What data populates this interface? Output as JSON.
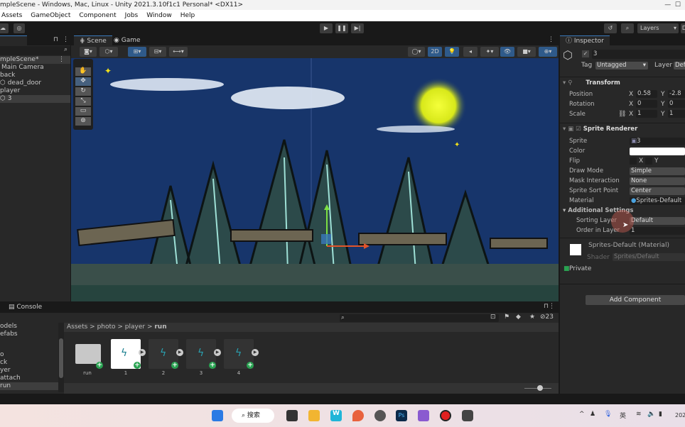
{
  "window": {
    "title": "mpleScene - Windows, Mac, Linux - Unity 2021.3.10f1c1 Personal* <DX11>"
  },
  "menu": [
    "Assets",
    "GameObject",
    "Component",
    "Jobs",
    "Window",
    "Help"
  ],
  "toolbar": {
    "layers_label": "Layers",
    "play": "▶",
    "pause": "❚❚",
    "step": "▶|"
  },
  "hierarchy": {
    "scene": "mpleScene*",
    "items": [
      {
        "label": "Main Camera"
      },
      {
        "label": "back"
      },
      {
        "label": "dead_door"
      },
      {
        "label": "player"
      },
      {
        "label": "3"
      }
    ]
  },
  "scene": {
    "tabs": [
      "Scene",
      "Game"
    ],
    "mode_2d": "2D"
  },
  "inspector": {
    "tab": "Inspector",
    "object_name": "3",
    "tag_label": "Tag",
    "tag": "Untagged",
    "layer_label": "Layer",
    "layer": "Def",
    "transform": {
      "title": "Transform",
      "position": {
        "label": "Position",
        "x": "0.58",
        "y": "-2.8"
      },
      "rotation": {
        "label": "Rotation",
        "x": "0",
        "y": "0"
      },
      "scale": {
        "label": "Scale",
        "x": "1",
        "y": "1"
      }
    },
    "sprite_renderer": {
      "title": "Sprite Renderer",
      "sprite_label": "Sprite",
      "sprite": "3",
      "color_label": "Color",
      "flip_label": "Flip",
      "flip_x": "X",
      "flip_y": "Y",
      "draw_mode_label": "Draw Mode",
      "draw_mode": "Simple",
      "mask_label": "Mask Interaction",
      "mask": "None",
      "sort_point_label": "Sprite Sort Point",
      "sort_point": "Center",
      "material_label": "Material",
      "material": "Sprites-Default",
      "additional": "Additional Settings",
      "sorting_layer_label": "Sorting Layer",
      "sorting_layer": "Default",
      "order_label": "Order in Layer",
      "order": "1"
    },
    "material": {
      "name": "Sprites-Default (Material)",
      "shader_label": "Shader",
      "shader": "Sprites/Default",
      "private": "Private"
    },
    "add_component": "Add Component"
  },
  "console": {
    "tab": "Console"
  },
  "project": {
    "folders": [
      "odels",
      "efabs",
      "",
      "o",
      "ck",
      "yer",
      "attach",
      "run"
    ],
    "breadcrumb": [
      "Assets",
      "photo",
      "player",
      "run"
    ],
    "assets": [
      {
        "name": "run",
        "type": "folder"
      },
      {
        "name": "1",
        "type": "sprite"
      },
      {
        "name": "2",
        "type": "sprite"
      },
      {
        "name": "3",
        "type": "sprite"
      },
      {
        "name": "4",
        "type": "sprite"
      }
    ],
    "hidden_count": "23"
  },
  "taskbar": {
    "search": "搜索",
    "ime": "英",
    "clock": "202"
  },
  "colors": {
    "accent": "#3a79bb",
    "sky": "#17356b",
    "sun": "#e8f21c"
  }
}
